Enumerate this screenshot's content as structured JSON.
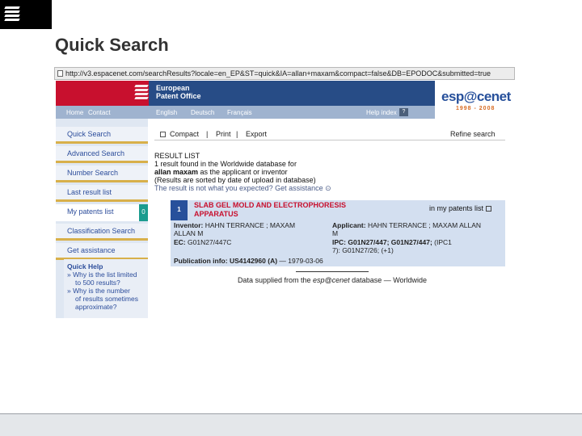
{
  "slide": {
    "title": "Quick Search"
  },
  "browser": {
    "url": "http://v3.espacenet.com/searchResults?locale=en_EP&ST=quick&IA=allan+maxam&compact=false&DB=EPODOC&submitted=true"
  },
  "header": {
    "org_line1": "European",
    "org_line2": "Patent Office",
    "nav": [
      "Home",
      "Contact",
      "English",
      "Deutsch",
      "Français",
      "Help index"
    ],
    "help_symbol": "?",
    "logo_text": "esp@cenet",
    "logo_years": "1998 - 2008"
  },
  "sidebar": {
    "items": [
      {
        "label": "Quick Search"
      },
      {
        "label": "Advanced Search"
      },
      {
        "label": "Number Search"
      },
      {
        "label": "Last result list"
      },
      {
        "label": "My patents list",
        "badge": "0"
      },
      {
        "label": "Classification Search"
      },
      {
        "label": "Get assistance"
      }
    ],
    "quick_help": {
      "title": "Quick Help",
      "lines": [
        "» Why is the list limited",
        "   to 500 results?",
        "» Why is the number",
        "   of results sometimes",
        "   approximate?"
      ]
    }
  },
  "toolbar": {
    "compact": "Compact",
    "sep1": "|",
    "print": "Print",
    "sep2": "|",
    "export": "Export",
    "refine": "Refine search"
  },
  "results": {
    "heading": "RESULT LIST",
    "line1": "1 result found in the Worldwide database for",
    "line2_bold": "allan maxam",
    "line2_rest": " as the applicant or inventor",
    "line3": "(Results are sorted by date of upload in database)",
    "line4": "The result is not what you expected? Get assistance",
    "line4_arrow": "⊙"
  },
  "result_item": {
    "number": "1",
    "title_line1": "SLAB GEL MOLD AND ELECTROPHORESIS",
    "title_line2": "APPARATUS",
    "my_list": "in my patents list",
    "inventor_label": "Inventor:",
    "inventor_value1": "HAHN TERRANCE ; MAXAM",
    "inventor_value2": "ALLAN M",
    "applicant_label": "Applicant:",
    "applicant_value1": "HAHN TERRANCE ; MAXAM ALLAN",
    "applicant_value2": "M",
    "ec_label": "EC:",
    "ec_value": "G01N27/447C",
    "ipc_label": "IPC:",
    "ipc_value1": "G01N27/447; G01N27/447;",
    "ipc_value1b": " (IPC1",
    "ipc_value2": "7): G01N27/26; (+1)",
    "pub_label": "Publication info:",
    "pub_number": "US4142960",
    "pub_kind": "(A)",
    "pub_date": "— 1979-03-06"
  },
  "footer": {
    "supply_prefix": "Data supplied from the ",
    "supply_brand": "esp@cenet",
    "supply_suffix": " database — Worldwide"
  },
  "colors": {
    "epo_red": "#c8102e",
    "epo_blue": "#274c86",
    "link_blue": "#2c4d9b",
    "card_bg": "#d3dff0",
    "highlight_gold": "#d8b04a",
    "badge_teal": "#1b9c8f"
  }
}
